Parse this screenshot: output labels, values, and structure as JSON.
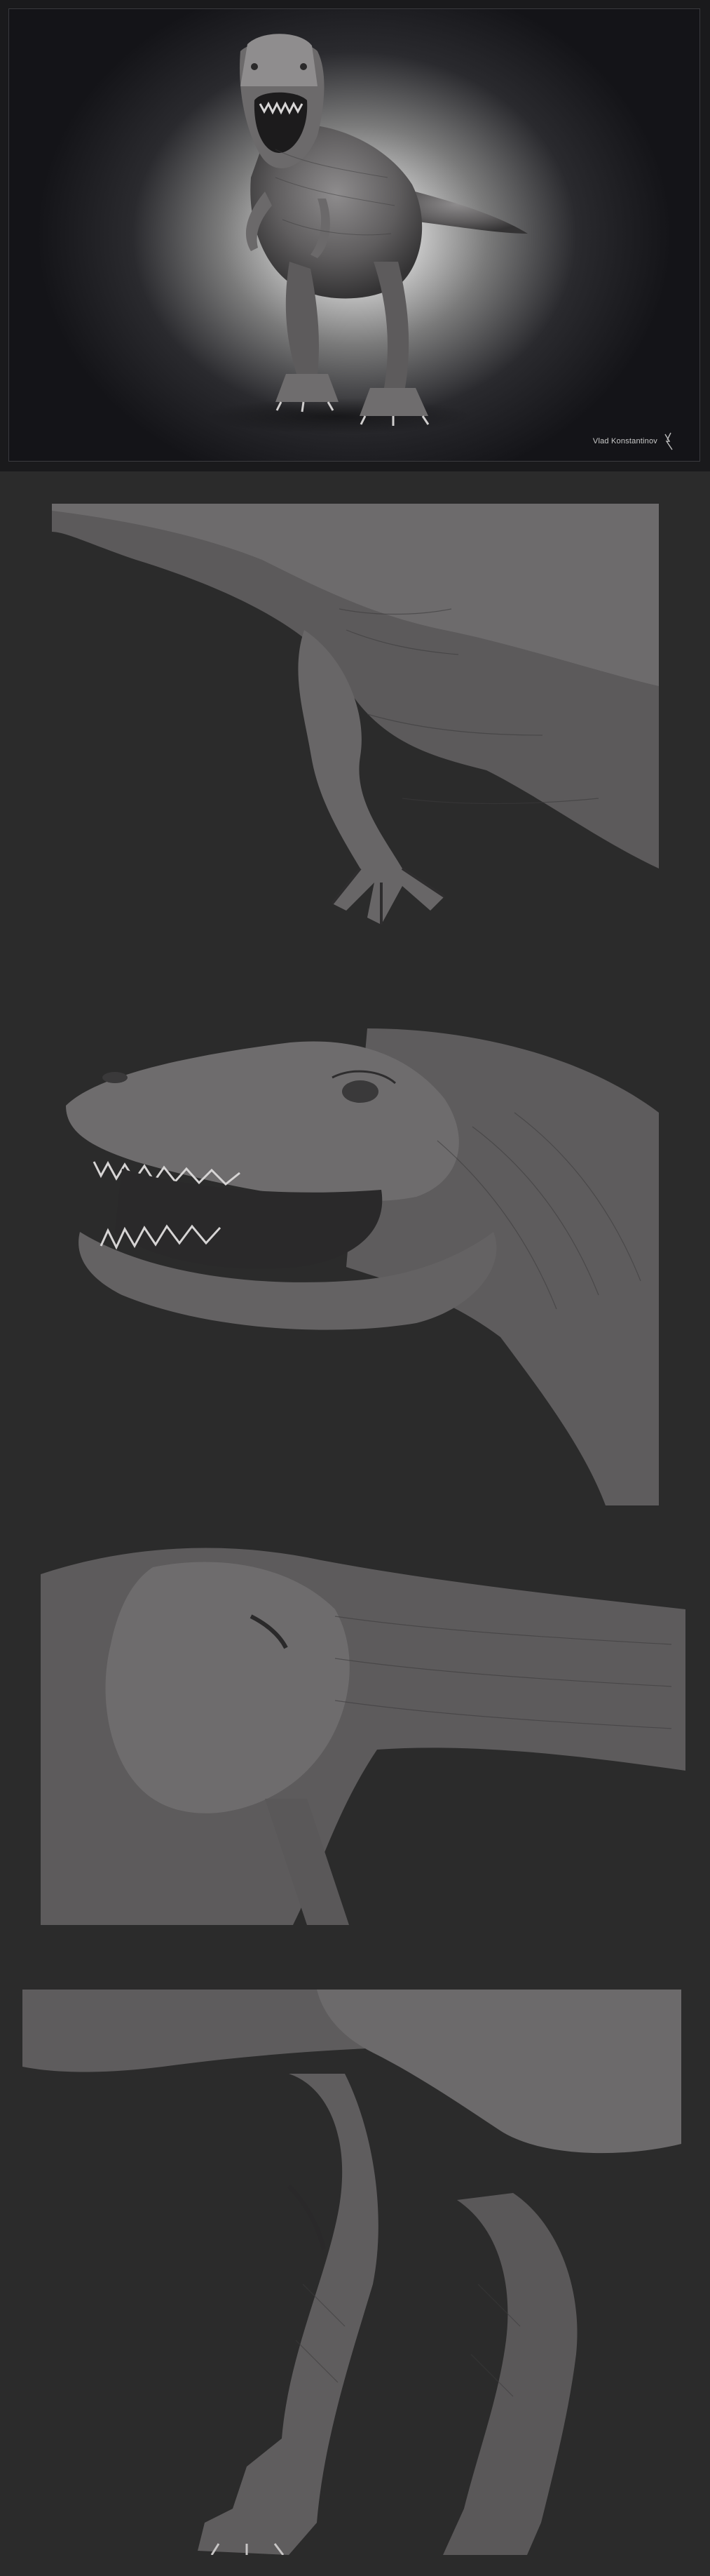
{
  "artwork": {
    "signature": "Vlad Konstantinov"
  },
  "panels": [
    {
      "id": "full-body-render",
      "subject": "T-rex full body front view"
    },
    {
      "id": "forearm-detail",
      "subject": "arm and chest skin detail"
    },
    {
      "id": "head-detail",
      "subject": "open-jaw head detail"
    },
    {
      "id": "thigh-detail",
      "subject": "thigh and tail base detail"
    },
    {
      "id": "legs-detail",
      "subject": "lower legs and feet detail"
    }
  ],
  "colors": {
    "page_background": "#2b2b2b",
    "clay": "#5a5859",
    "clay_highlight": "#8b8889",
    "clay_shadow": "#2e2d2e"
  }
}
